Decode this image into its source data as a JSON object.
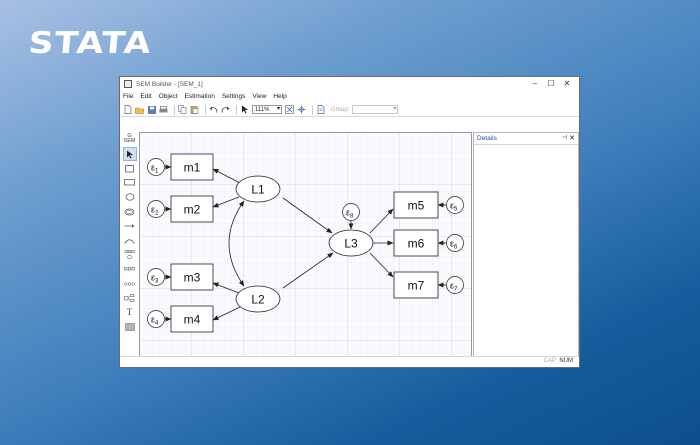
{
  "brand": "STATA",
  "window": {
    "title": "SEM Builder - [SEM_1]",
    "controls": [
      "–",
      "☐",
      "✕"
    ]
  },
  "menu": [
    "File",
    "Edit",
    "Object",
    "Estimation",
    "Settings",
    "View",
    "Help"
  ],
  "toolbar": {
    "zoom": "111%",
    "group_label": "Group:",
    "group_value": ""
  },
  "tools": {
    "gsem": [
      "G",
      "SEM"
    ],
    "items": [
      "select-arrow",
      "observed-variable",
      "observed-variable-wide",
      "latent-variable",
      "latent-variable-wide",
      "path",
      "covariance",
      "measurement-component",
      "regression-component",
      "latent-regression",
      "multilevel-component",
      "text",
      "area"
    ],
    "text_tool_label": "T"
  },
  "details": {
    "title": "Details",
    "pin": "⊣",
    "close": "✕"
  },
  "status": {
    "cap": "CAP",
    "num": "NUM"
  },
  "diagram": {
    "observed": [
      "m1",
      "m2",
      "m3",
      "m4",
      "m5",
      "m6",
      "m7"
    ],
    "latent": [
      "L1",
      "L2",
      "L3"
    ],
    "errors": [
      {
        "sym": "ε",
        "sub": "1"
      },
      {
        "sym": "ε",
        "sub": "2"
      },
      {
        "sym": "ε",
        "sub": "3"
      },
      {
        "sym": "ε",
        "sub": "4"
      },
      {
        "sym": "ε",
        "sub": "5"
      },
      {
        "sym": "ε",
        "sub": "6"
      },
      {
        "sym": "ε",
        "sub": "7"
      },
      {
        "sym": "ε",
        "sub": "8"
      }
    ]
  }
}
